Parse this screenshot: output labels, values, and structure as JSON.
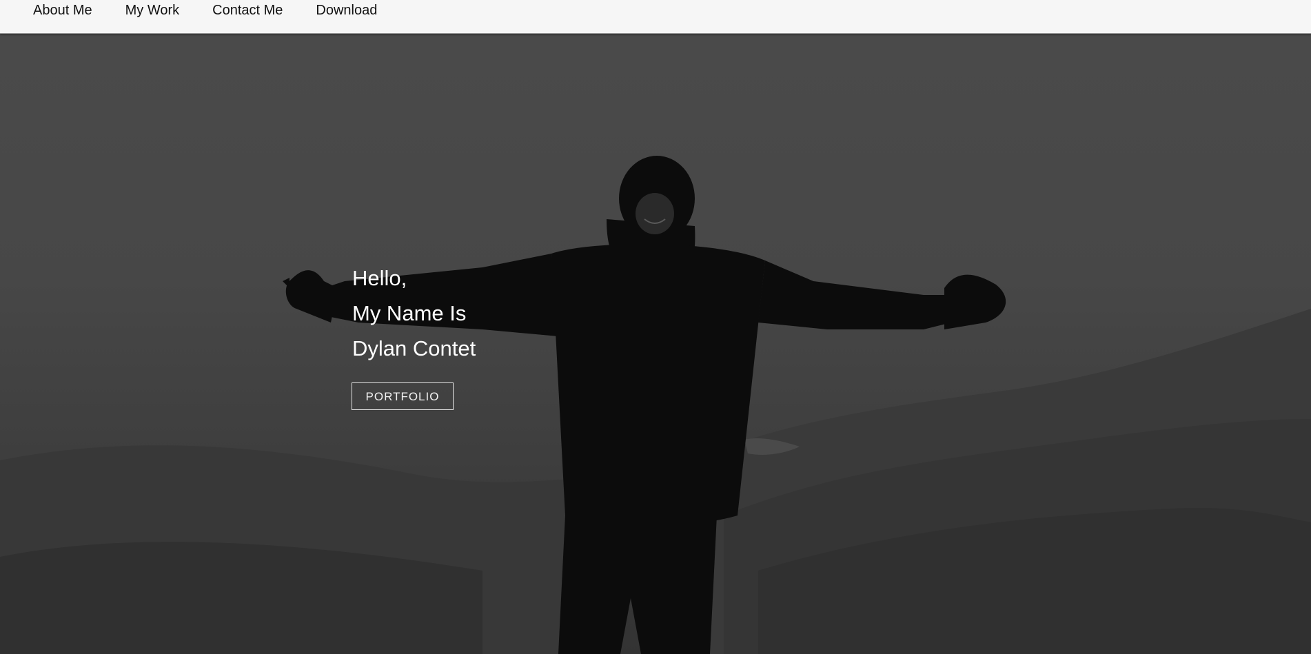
{
  "nav": {
    "items": [
      {
        "label": "About Me"
      },
      {
        "label": "My Work"
      },
      {
        "label": "Contact Me"
      },
      {
        "label": "Download"
      }
    ]
  },
  "hero": {
    "lines": [
      "Hello,",
      "My Name Is",
      "Dylan Contet"
    ],
    "button_label": "PORTFOLIO",
    "background_image": "dark photo of person with outstretched arms on misty mountain"
  },
  "colors": {
    "nav_bg": "#f6f6f6",
    "hero_overlay": "#3d3d3d",
    "text": "#ffffff"
  }
}
